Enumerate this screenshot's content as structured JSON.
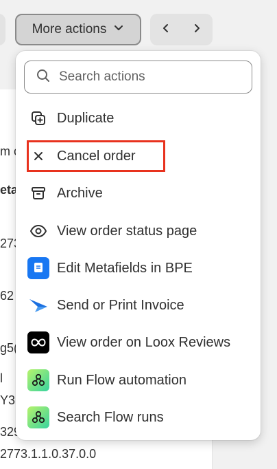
{
  "toolbar": {
    "more_actions_label": "More actions"
  },
  "background": {
    "fragments": [
      "m c",
      "eta",
      "273",
      "62",
      "g5(",
      "l",
      "Y3",
      "329",
      "2773.1.1.0.37.0.0"
    ]
  },
  "menu": {
    "search_placeholder": "Search actions",
    "items": [
      {
        "label": "Duplicate",
        "icon": "duplicate-icon"
      },
      {
        "label": "Cancel order",
        "icon": "x-icon"
      },
      {
        "label": "Archive",
        "icon": "archive-icon"
      },
      {
        "label": "View order status page",
        "icon": "eye-icon"
      },
      {
        "label": "Edit Metafields in BPE",
        "icon": "bpe-hextom-app-icon"
      },
      {
        "label": "Send or Print Invoice",
        "icon": "invoice-app-icon"
      },
      {
        "label": "View order on Loox Reviews",
        "icon": "loox-app-icon"
      },
      {
        "label": "Run Flow automation",
        "icon": "flow-app-icon"
      },
      {
        "label": "Search Flow runs",
        "icon": "flow-app-icon"
      }
    ]
  },
  "colors": {
    "highlight": "#e8321e",
    "bpe_blue": "#1877f2",
    "invoice_blue": "#1a6fe0",
    "loox_black": "#000000",
    "flow_green": "#4ade80"
  }
}
